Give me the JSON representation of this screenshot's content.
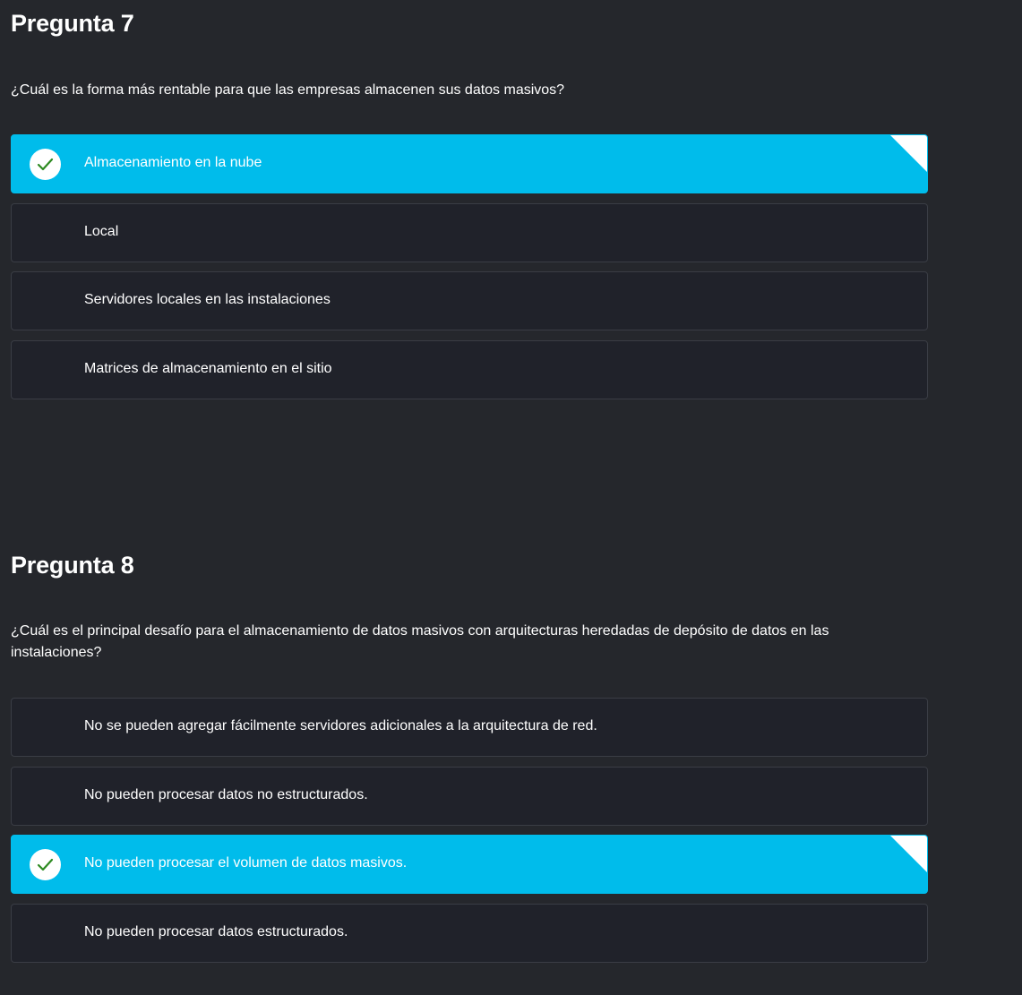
{
  "questions": [
    {
      "title": "Pregunta 7",
      "text": "¿Cuál es la forma más rentable para que las empresas almacenen sus datos masivos?",
      "options": [
        {
          "label": "Almacenamiento en la nube",
          "correct": true
        },
        {
          "label": "Local",
          "correct": false
        },
        {
          "label": "Servidores locales en las instalaciones",
          "correct": false
        },
        {
          "label": "Matrices de almacenamiento en el sitio",
          "correct": false
        }
      ]
    },
    {
      "title": "Pregunta 8",
      "text": "¿Cuál es el principal desafío para el almacenamiento de datos masivos con arquitecturas heredadas de depósito de datos en las instalaciones?",
      "options": [
        {
          "label": "No se pueden agregar fácilmente servidores adicionales a la arquitectura de red.",
          "correct": false
        },
        {
          "label": "No pueden procesar datos no estructurados.",
          "correct": false
        },
        {
          "label": "No pueden procesar el volumen de datos masivos.",
          "correct": true
        },
        {
          "label": "No pueden procesar datos estructurados.",
          "correct": false
        }
      ]
    }
  ],
  "colors": {
    "background": "#25272c",
    "option_background": "#20222a",
    "option_border": "#3a3d45",
    "correct_background": "#00bceb",
    "checkmark": "#2e8b22"
  },
  "icons": {
    "check": "checkmark-icon",
    "corner": "corner-fold-icon"
  }
}
